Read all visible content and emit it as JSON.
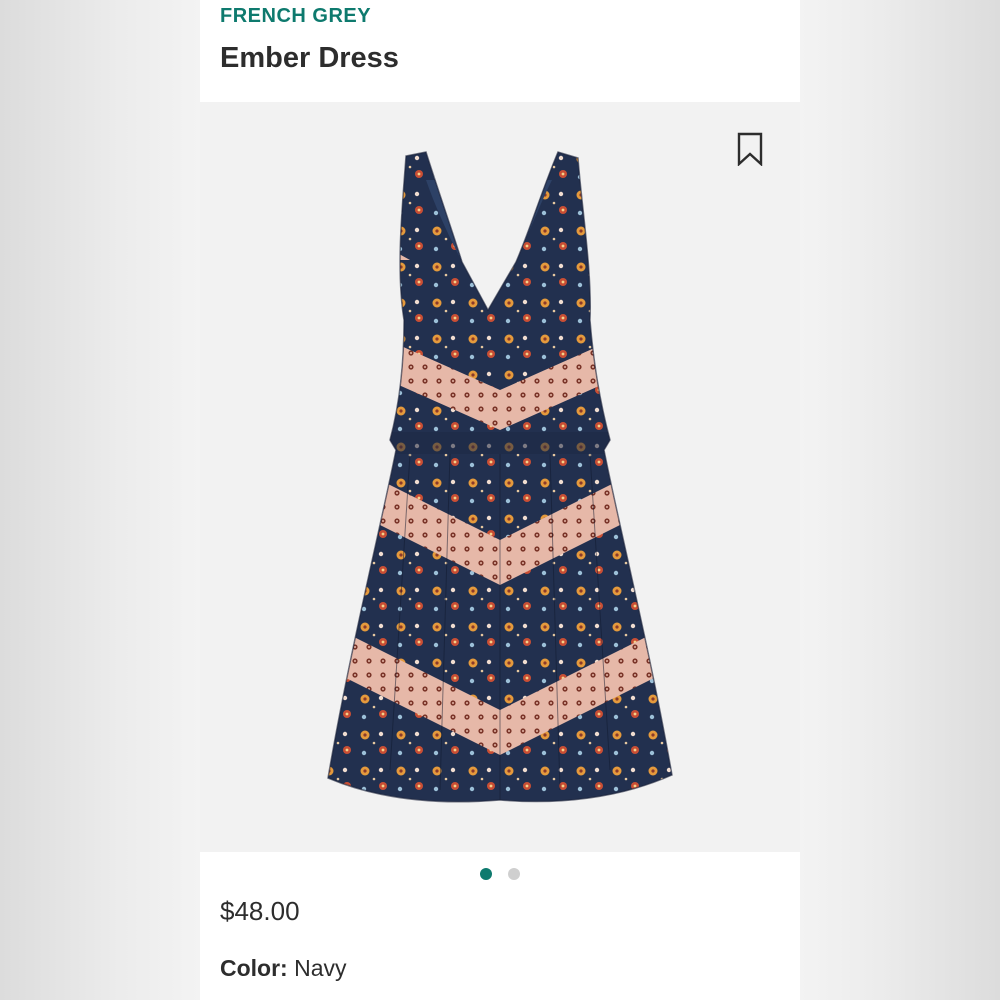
{
  "product": {
    "brand": "FRENCH GREY",
    "name": "Ember Dress",
    "price": "$48.00",
    "color_label": "Color:",
    "color_value": "Navy"
  },
  "image": {
    "description_icon": "dress-image",
    "slide_count": 2,
    "active_slide": 1
  },
  "icons": {
    "bookmark": "bookmark-icon"
  },
  "colors": {
    "brand": "#0e7a6e",
    "text": "#2d2d2d",
    "dot_inactive": "#cfcfcf",
    "dress_navy": "#22304f",
    "dress_pink": "#e6b8a8",
    "dress_orange": "#e59a3c"
  }
}
